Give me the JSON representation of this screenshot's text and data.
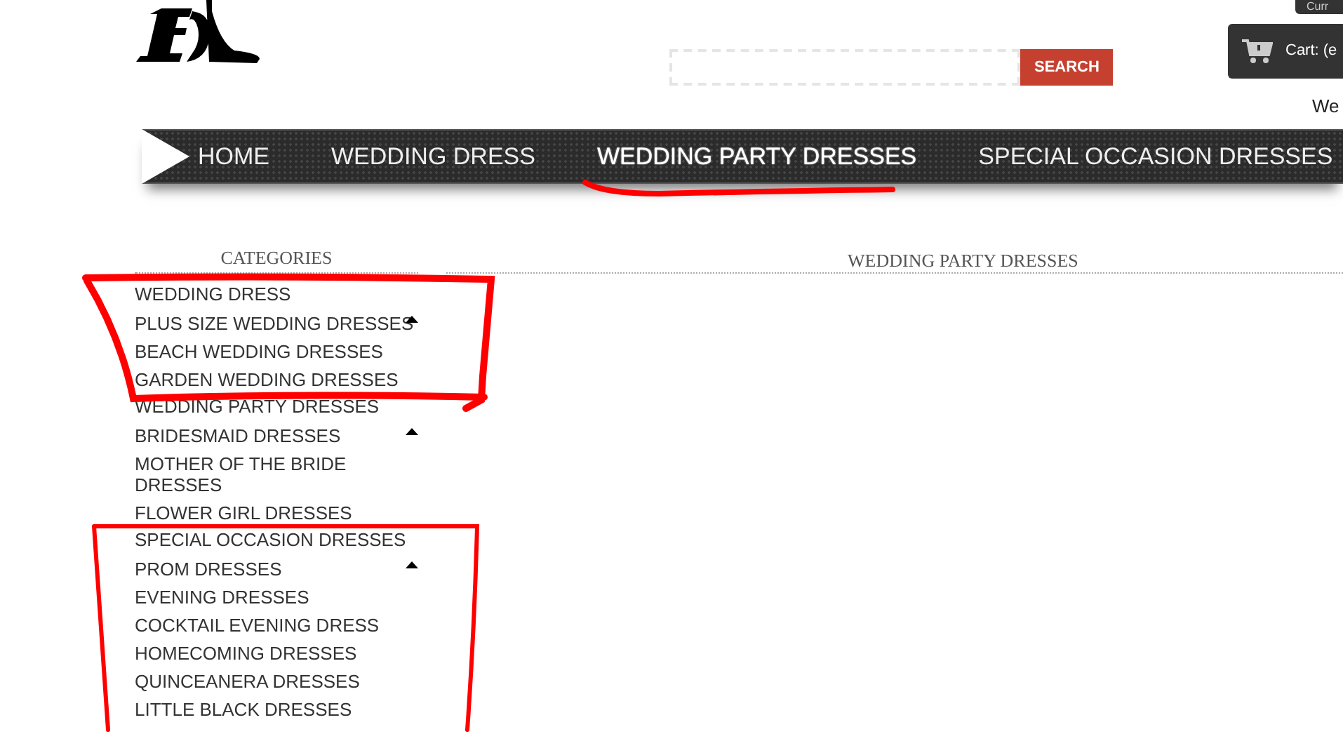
{
  "header": {
    "search": {
      "button": "SEARCH"
    },
    "currency_tab": "Curr",
    "cart": "Cart: (e",
    "welcome": "We"
  },
  "nav": [
    {
      "label": "HOME",
      "selected": false
    },
    {
      "label": "WEDDING DRESS",
      "selected": false
    },
    {
      "label": "WEDDING PARTY DRESSES",
      "selected": true
    },
    {
      "label": "SPECIAL OCCASION DRESSES",
      "selected": false
    }
  ],
  "sidebar": {
    "title": "CATEGORIES",
    "items": [
      {
        "label": "WEDDING DRESS",
        "expanded": true,
        "children": [
          {
            "label": "PLUS SIZE WEDDING DRESSES"
          },
          {
            "label": "BEACH WEDDING DRESSES"
          },
          {
            "label": "GARDEN WEDDING DRESSES"
          }
        ]
      },
      {
        "label": "WEDDING PARTY DRESSES",
        "expanded": true,
        "children": [
          {
            "label": "BRIDESMAID DRESSES"
          },
          {
            "label": "MOTHER OF THE BRIDE DRESSES"
          },
          {
            "label": "FLOWER GIRL DRESSES"
          }
        ]
      },
      {
        "label": "SPECIAL OCCASION DRESSES",
        "expanded": true,
        "children": [
          {
            "label": "PROM DRESSES"
          },
          {
            "label": "EVENING DRESSES"
          },
          {
            "label": "COCKTAIL EVENING DRESS"
          },
          {
            "label": "HOMECOMING DRESSES"
          },
          {
            "label": "QUINCEANERA DRESSES"
          },
          {
            "label": "LITTLE BLACK DRESSES"
          }
        ]
      }
    ]
  },
  "main": {
    "title": "WEDDING PARTY DRESSES"
  }
}
